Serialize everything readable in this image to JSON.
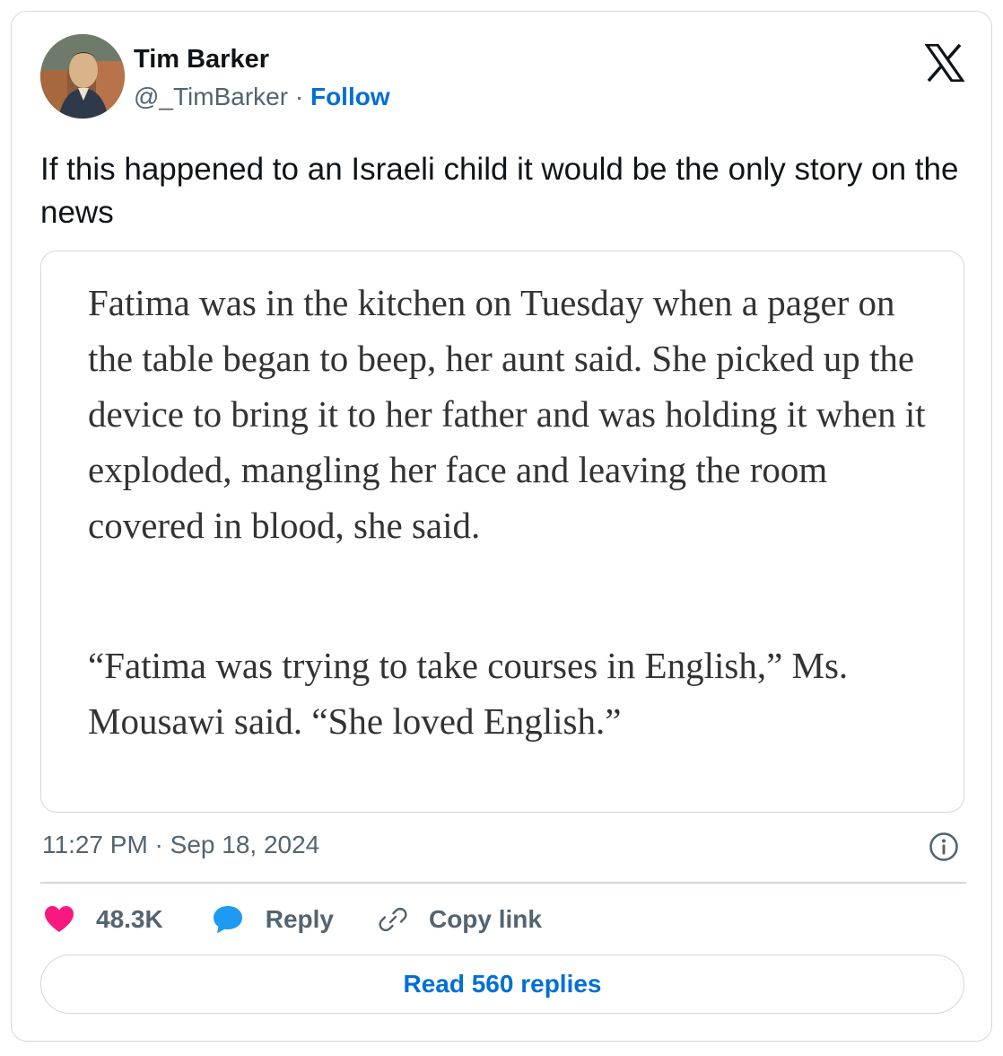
{
  "author": {
    "name": "Tim Barker",
    "handle": "@_TimBarker",
    "separator": "·",
    "follow_label": "Follow"
  },
  "tweet": {
    "text": "If this happened to an Israeli child it would be the only story on the news"
  },
  "quoted_image": {
    "paragraph_1": "Fatima was in the kitchen on Tuesday when a pager on the table began to beep, her aunt said. She picked up the device to bring it to her father and was holding it when it exploded, mangling her face and leaving the room covered in blood, she said.",
    "paragraph_2": "“Fatima was trying to take courses in English,” Ms. Mousawi said. “She loved English.”"
  },
  "timestamp": "11:27 PM · Sep 18, 2024",
  "actions": {
    "likes_count": "48.3K",
    "reply_label": "Reply",
    "copy_link_label": "Copy link"
  },
  "read_replies_label": "Read 560 replies",
  "colors": {
    "like": "#f91880",
    "reply": "#1d9bf0",
    "link": "#006fd6",
    "muted": "#536471",
    "border": "#cfd9de"
  },
  "icons": [
    "avatar",
    "x-logo-icon",
    "info-icon",
    "heart-icon",
    "reply-bubble-icon",
    "link-icon"
  ]
}
